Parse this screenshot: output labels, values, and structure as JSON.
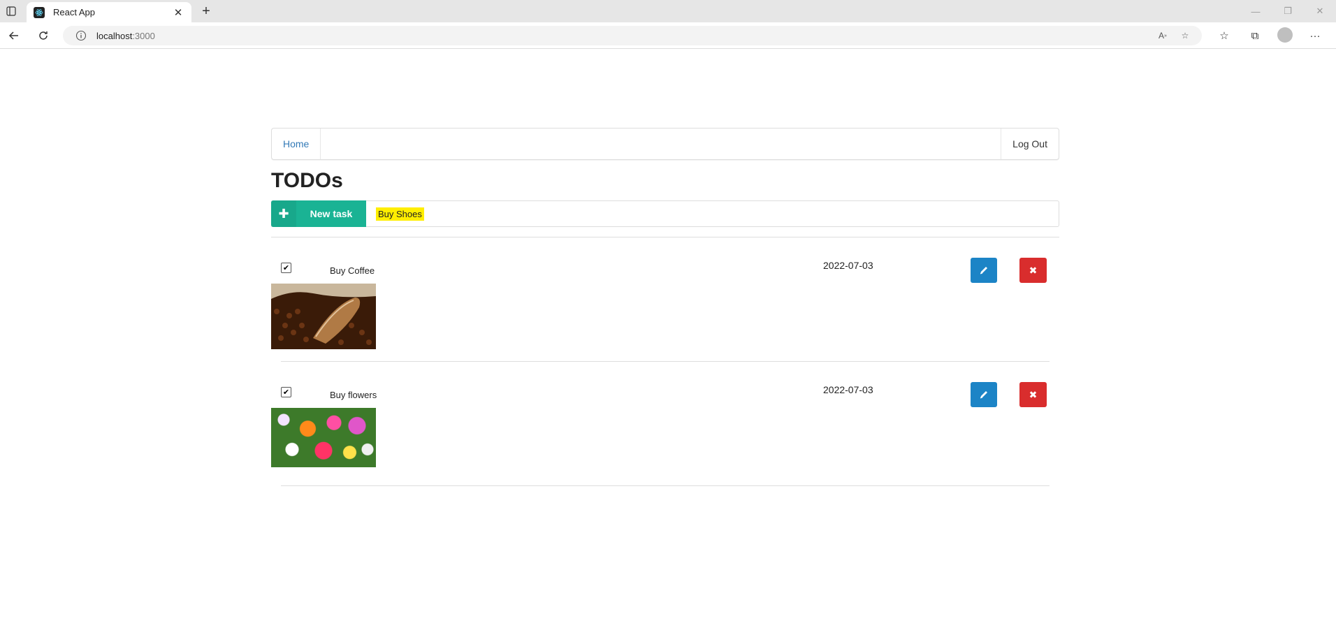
{
  "browser": {
    "tab_title": "React App",
    "url_host": "localhost",
    "url_port": ":3000"
  },
  "nav": {
    "home_label": "Home",
    "logout_label": "Log Out"
  },
  "page": {
    "title": "TODOs",
    "new_task_label": "New task",
    "new_task_value": "Buy Shoes"
  },
  "todos": [
    {
      "name": "Buy Coffee",
      "date": "2022-07-03",
      "checked": true
    },
    {
      "name": "Buy flowers",
      "date": "2022-07-03",
      "checked": true
    }
  ],
  "colors": {
    "new_task_button": "#1ab394",
    "edit_button": "#1c84c6",
    "delete_button": "#d92d2d",
    "highlight": "#ffee00",
    "link": "#337ab7"
  }
}
